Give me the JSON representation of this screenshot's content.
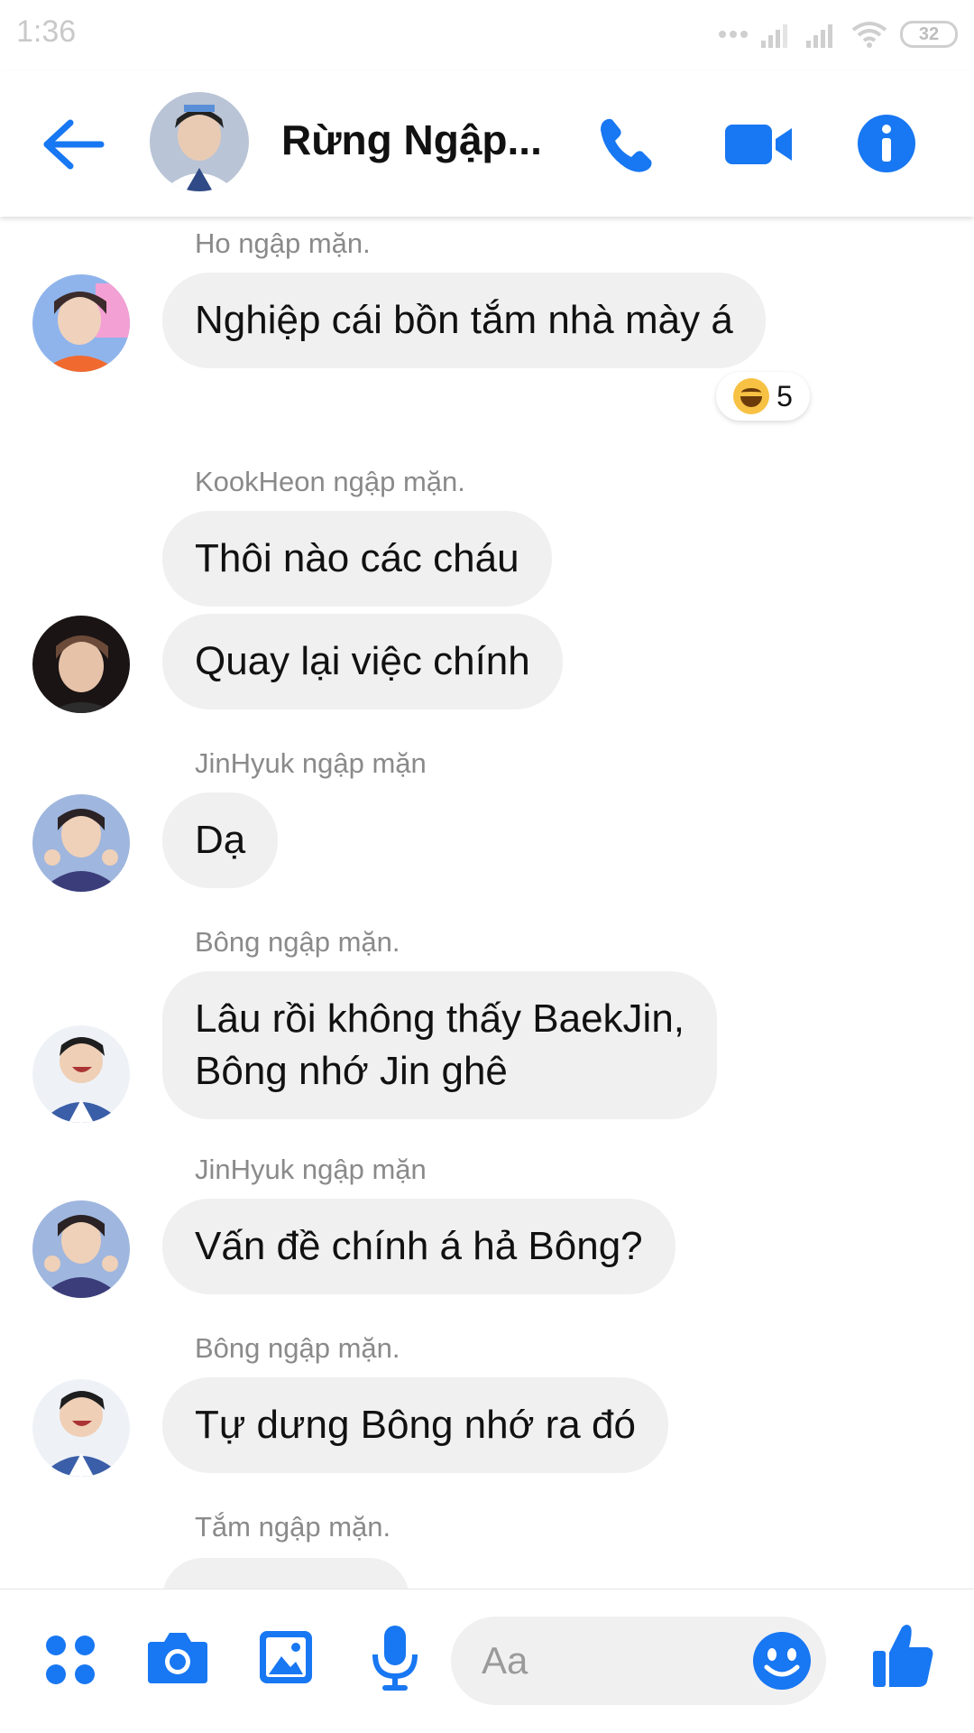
{
  "status_bar": {
    "time": "1:36",
    "battery": "32"
  },
  "header": {
    "title": "Rừng Ngập..."
  },
  "colors": {
    "accent": "#1877f2",
    "bubble": "#f1f0f0",
    "sender_text": "#8a8a8a"
  },
  "messages": [
    {
      "sender": "Ho ngập mặn.",
      "text": "Nghiệp cái bồn tắm nhà mày á",
      "reaction": {
        "emoji": "laughing-face",
        "count": "5"
      }
    },
    {
      "sender": "KookHeon ngập mặn.",
      "texts": [
        "Thôi nào các cháu",
        "Quay lại việc chính"
      ]
    },
    {
      "sender": "JinHyuk ngập mặn",
      "text": "Dạ"
    },
    {
      "sender": "Bông ngập mặn.",
      "lines": [
        "Lâu rồi không thấy BaekJin,",
        "Bông nhớ Jin ghê"
      ]
    },
    {
      "sender": "JinHyuk ngập mặn",
      "text": "Vấn đề chính á hả Bông?"
    },
    {
      "sender": "Bông ngập mặn.",
      "text": "Tự dưng Bông nhớ ra đó"
    },
    {
      "sender": "Tắm ngập mặn."
    }
  ],
  "composer": {
    "placeholder": "Aa"
  }
}
